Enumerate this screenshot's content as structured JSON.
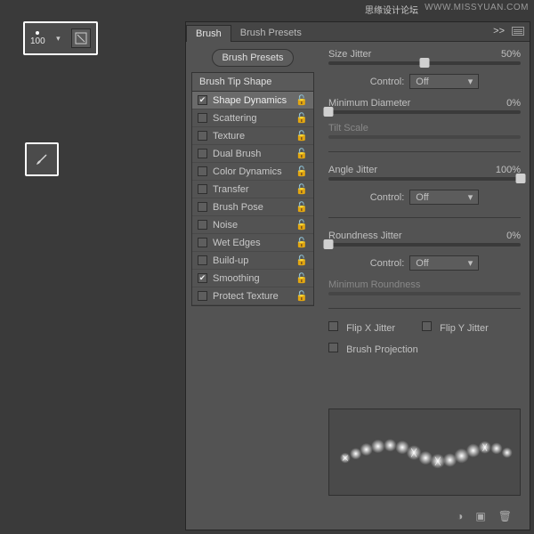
{
  "watermark_site": "WWW.MISSYUAN.COM",
  "watermark_cn": "思缘设计论坛",
  "brush_box": {
    "size": "100"
  },
  "tabs": {
    "brush": "Brush",
    "presets": "Brush Presets",
    "expand": ">>"
  },
  "brush_presets_btn": "Brush Presets",
  "list_header": "Brush Tip Shape",
  "options": [
    {
      "label": "Shape Dynamics",
      "checked": true,
      "active": true
    },
    {
      "label": "Scattering",
      "checked": false
    },
    {
      "label": "Texture",
      "checked": false
    },
    {
      "label": "Dual Brush",
      "checked": false
    },
    {
      "label": "Color Dynamics",
      "checked": false
    },
    {
      "label": "Transfer",
      "checked": false
    },
    {
      "label": "Brush Pose",
      "checked": false
    },
    {
      "label": "Noise",
      "checked": false
    },
    {
      "label": "Wet Edges",
      "checked": false
    },
    {
      "label": "Build-up",
      "checked": false
    },
    {
      "label": "Smoothing",
      "checked": true
    },
    {
      "label": "Protect Texture",
      "checked": false
    }
  ],
  "controls": {
    "size_jitter": {
      "label": "Size Jitter",
      "value": "50%"
    },
    "control1": {
      "label": "Control:",
      "value": "Off"
    },
    "min_diameter": {
      "label": "Minimum Diameter",
      "value": "0%"
    },
    "tilt_scale": {
      "label": "Tilt Scale"
    },
    "angle_jitter": {
      "label": "Angle Jitter",
      "value": "100%"
    },
    "control2": {
      "label": "Control:",
      "value": "Off"
    },
    "roundness_jitter": {
      "label": "Roundness Jitter",
      "value": "0%"
    },
    "control3": {
      "label": "Control:",
      "value": "Off"
    },
    "min_roundness": {
      "label": "Minimum Roundness"
    },
    "flip_x": "Flip X Jitter",
    "flip_y": "Flip Y Jitter",
    "brush_proj": "Brush Projection"
  }
}
